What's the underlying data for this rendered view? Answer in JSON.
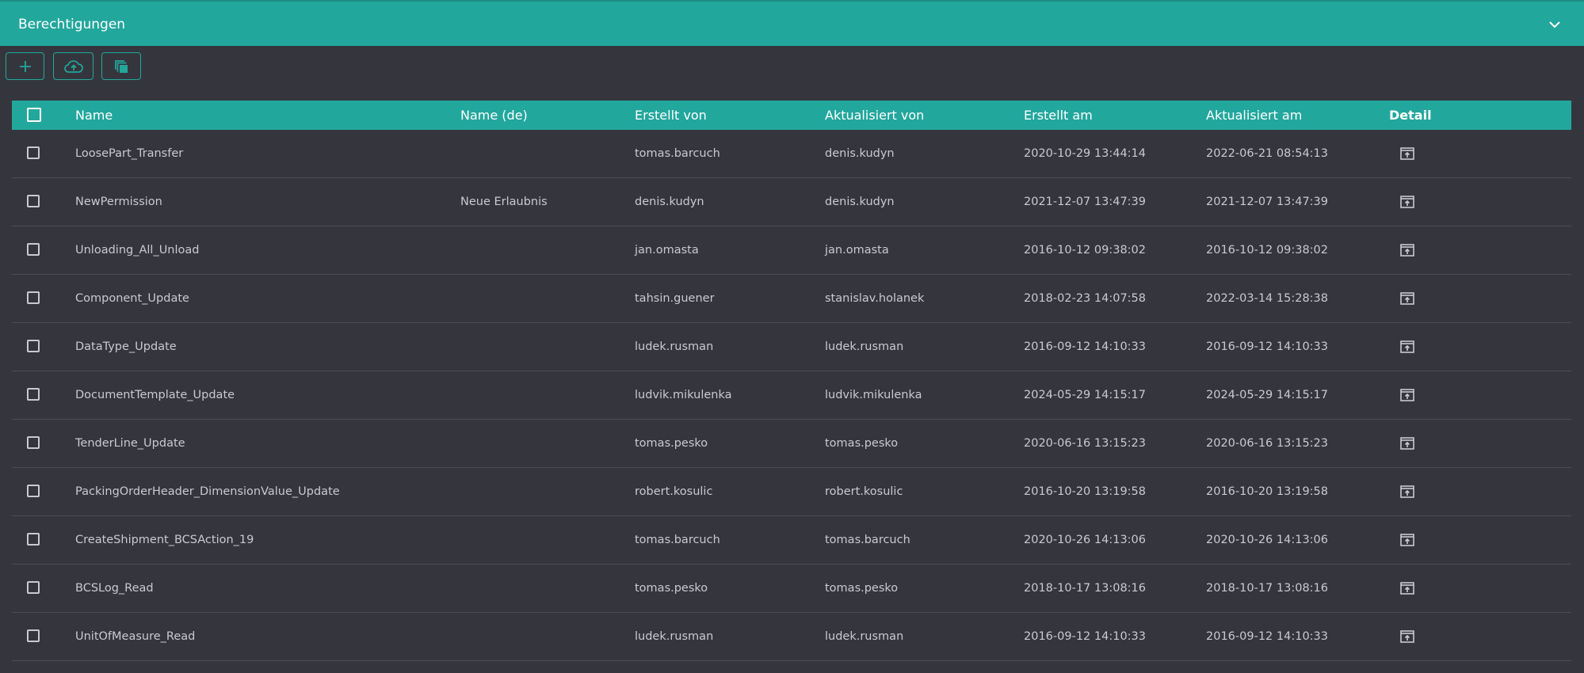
{
  "panel": {
    "title": "Berechtigungen",
    "collapse_icon": "chevron-down-icon"
  },
  "toolbar": {
    "add_icon": "plus-icon",
    "upload_icon": "cloud-upload-icon",
    "copy_icon": "copy-icon"
  },
  "table": {
    "columns": [
      "Name",
      "Name (de)",
      "Erstellt von",
      "Aktualisiert von",
      "Erstellt am",
      "Aktualisiert am",
      "Detail"
    ],
    "rows": [
      {
        "name": "LoosePart_Transfer",
        "name_de": "",
        "created_by": "tomas.barcuch",
        "updated_by": "denis.kudyn",
        "created_at": "2020-10-29 13:44:14",
        "updated_at": "2022-06-21 08:54:13"
      },
      {
        "name": "NewPermission",
        "name_de": "Neue Erlaubnis",
        "created_by": "denis.kudyn",
        "updated_by": "denis.kudyn",
        "created_at": "2021-12-07 13:47:39",
        "updated_at": "2021-12-07 13:47:39"
      },
      {
        "name": "Unloading_All_Unload",
        "name_de": "",
        "created_by": "jan.omasta",
        "updated_by": "jan.omasta",
        "created_at": "2016-10-12 09:38:02",
        "updated_at": "2016-10-12 09:38:02"
      },
      {
        "name": "Component_Update",
        "name_de": "",
        "created_by": "tahsin.guener",
        "updated_by": "stanislav.holanek",
        "created_at": "2018-02-23 14:07:58",
        "updated_at": "2022-03-14 15:28:38"
      },
      {
        "name": "DataType_Update",
        "name_de": "",
        "created_by": "ludek.rusman",
        "updated_by": "ludek.rusman",
        "created_at": "2016-09-12 14:10:33",
        "updated_at": "2016-09-12 14:10:33"
      },
      {
        "name": "DocumentTemplate_Update",
        "name_de": "",
        "created_by": "ludvik.mikulenka",
        "updated_by": "ludvik.mikulenka",
        "created_at": "2024-05-29 14:15:17",
        "updated_at": "2024-05-29 14:15:17"
      },
      {
        "name": "TenderLine_Update",
        "name_de": "",
        "created_by": "tomas.pesko",
        "updated_by": "tomas.pesko",
        "created_at": "2020-06-16 13:15:23",
        "updated_at": "2020-06-16 13:15:23"
      },
      {
        "name": "PackingOrderHeader_DimensionValue_Update",
        "name_de": "",
        "created_by": "robert.kosulic",
        "updated_by": "robert.kosulic",
        "created_at": "2016-10-20 13:19:58",
        "updated_at": "2016-10-20 13:19:58"
      },
      {
        "name": "CreateShipment_BCSAction_19",
        "name_de": "",
        "created_by": "tomas.barcuch",
        "updated_by": "tomas.barcuch",
        "created_at": "2020-10-26 14:13:06",
        "updated_at": "2020-10-26 14:13:06"
      },
      {
        "name": "BCSLog_Read",
        "name_de": "",
        "created_by": "tomas.pesko",
        "updated_by": "tomas.pesko",
        "created_at": "2018-10-17 13:08:16",
        "updated_at": "2018-10-17 13:08:16"
      },
      {
        "name": "UnitOfMeasure_Read",
        "name_de": "",
        "created_by": "ludek.rusman",
        "updated_by": "ludek.rusman",
        "created_at": "2016-09-12 14:10:33",
        "updated_at": "2016-09-12 14:10:33"
      }
    ],
    "detail_icon": "open-detail-icon"
  },
  "colors": {
    "accent": "#22a79d",
    "background": "#35363d"
  }
}
